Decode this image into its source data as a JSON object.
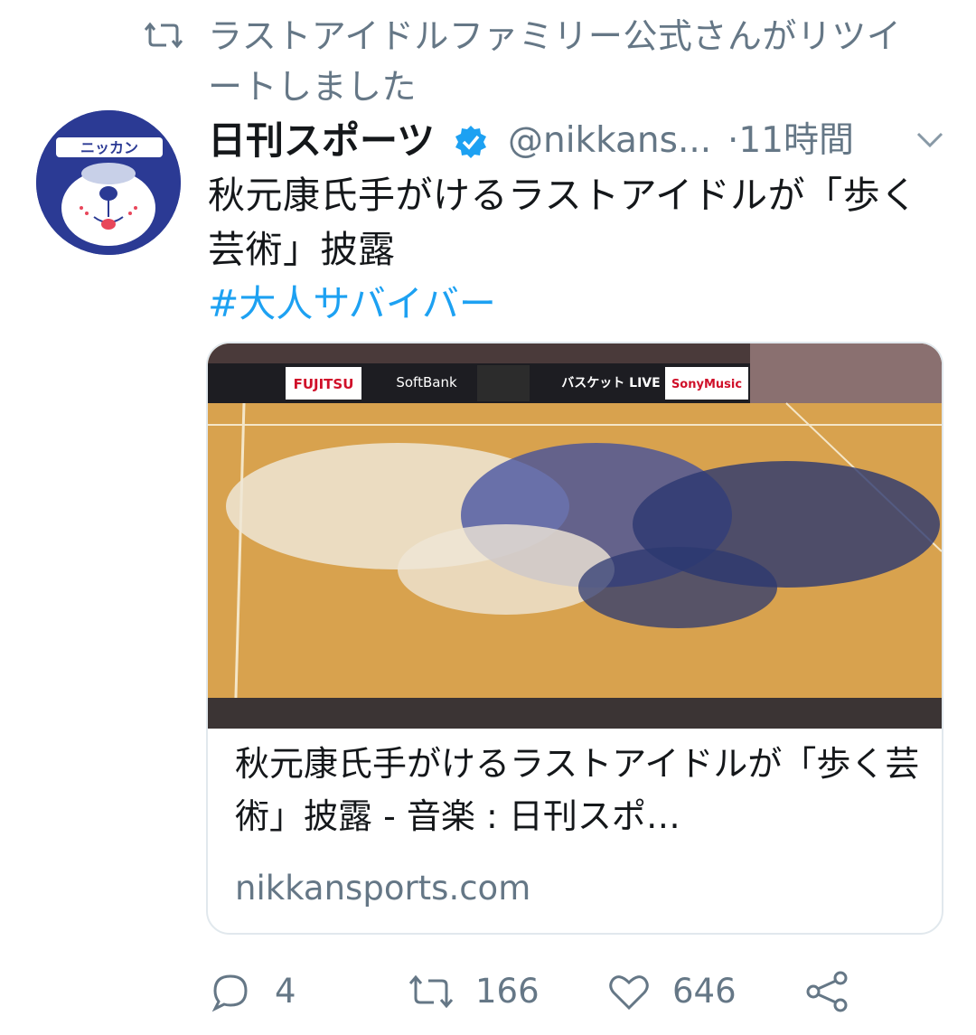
{
  "retweet": {
    "icon": "retweet-icon",
    "text": "ラストアイドルファミリー公式さんがリツイートしました"
  },
  "tweet": {
    "author_name": "日刊スポーツ",
    "verified_icon": "verified-badge-icon",
    "handle": "@nikkans...",
    "time": "·11時間",
    "text": "秋元康氏手がけるラストアイドルが「歩く芸術」披露",
    "hashtag": "#大人サバイバー"
  },
  "avatar": {
    "logo_text": "ニッカン"
  },
  "card": {
    "image_signs": [
      "FUJITSU",
      "SoftBank",
      "バスケット LIVE",
      "SonyMusic"
    ],
    "title": "秋元康氏手がけるラストアイドルが「歩く芸術」披露 - 音楽 : 日刊スポ…",
    "domain": "nikkansports.com"
  },
  "actions": {
    "reply_count": "4",
    "retweet_count": "166",
    "like_count": "646"
  },
  "colors": {
    "link": "#1da1f2",
    "secondary_text": "#657786",
    "avatar_bg": "#2b3a94",
    "court": "#d8a24e"
  }
}
